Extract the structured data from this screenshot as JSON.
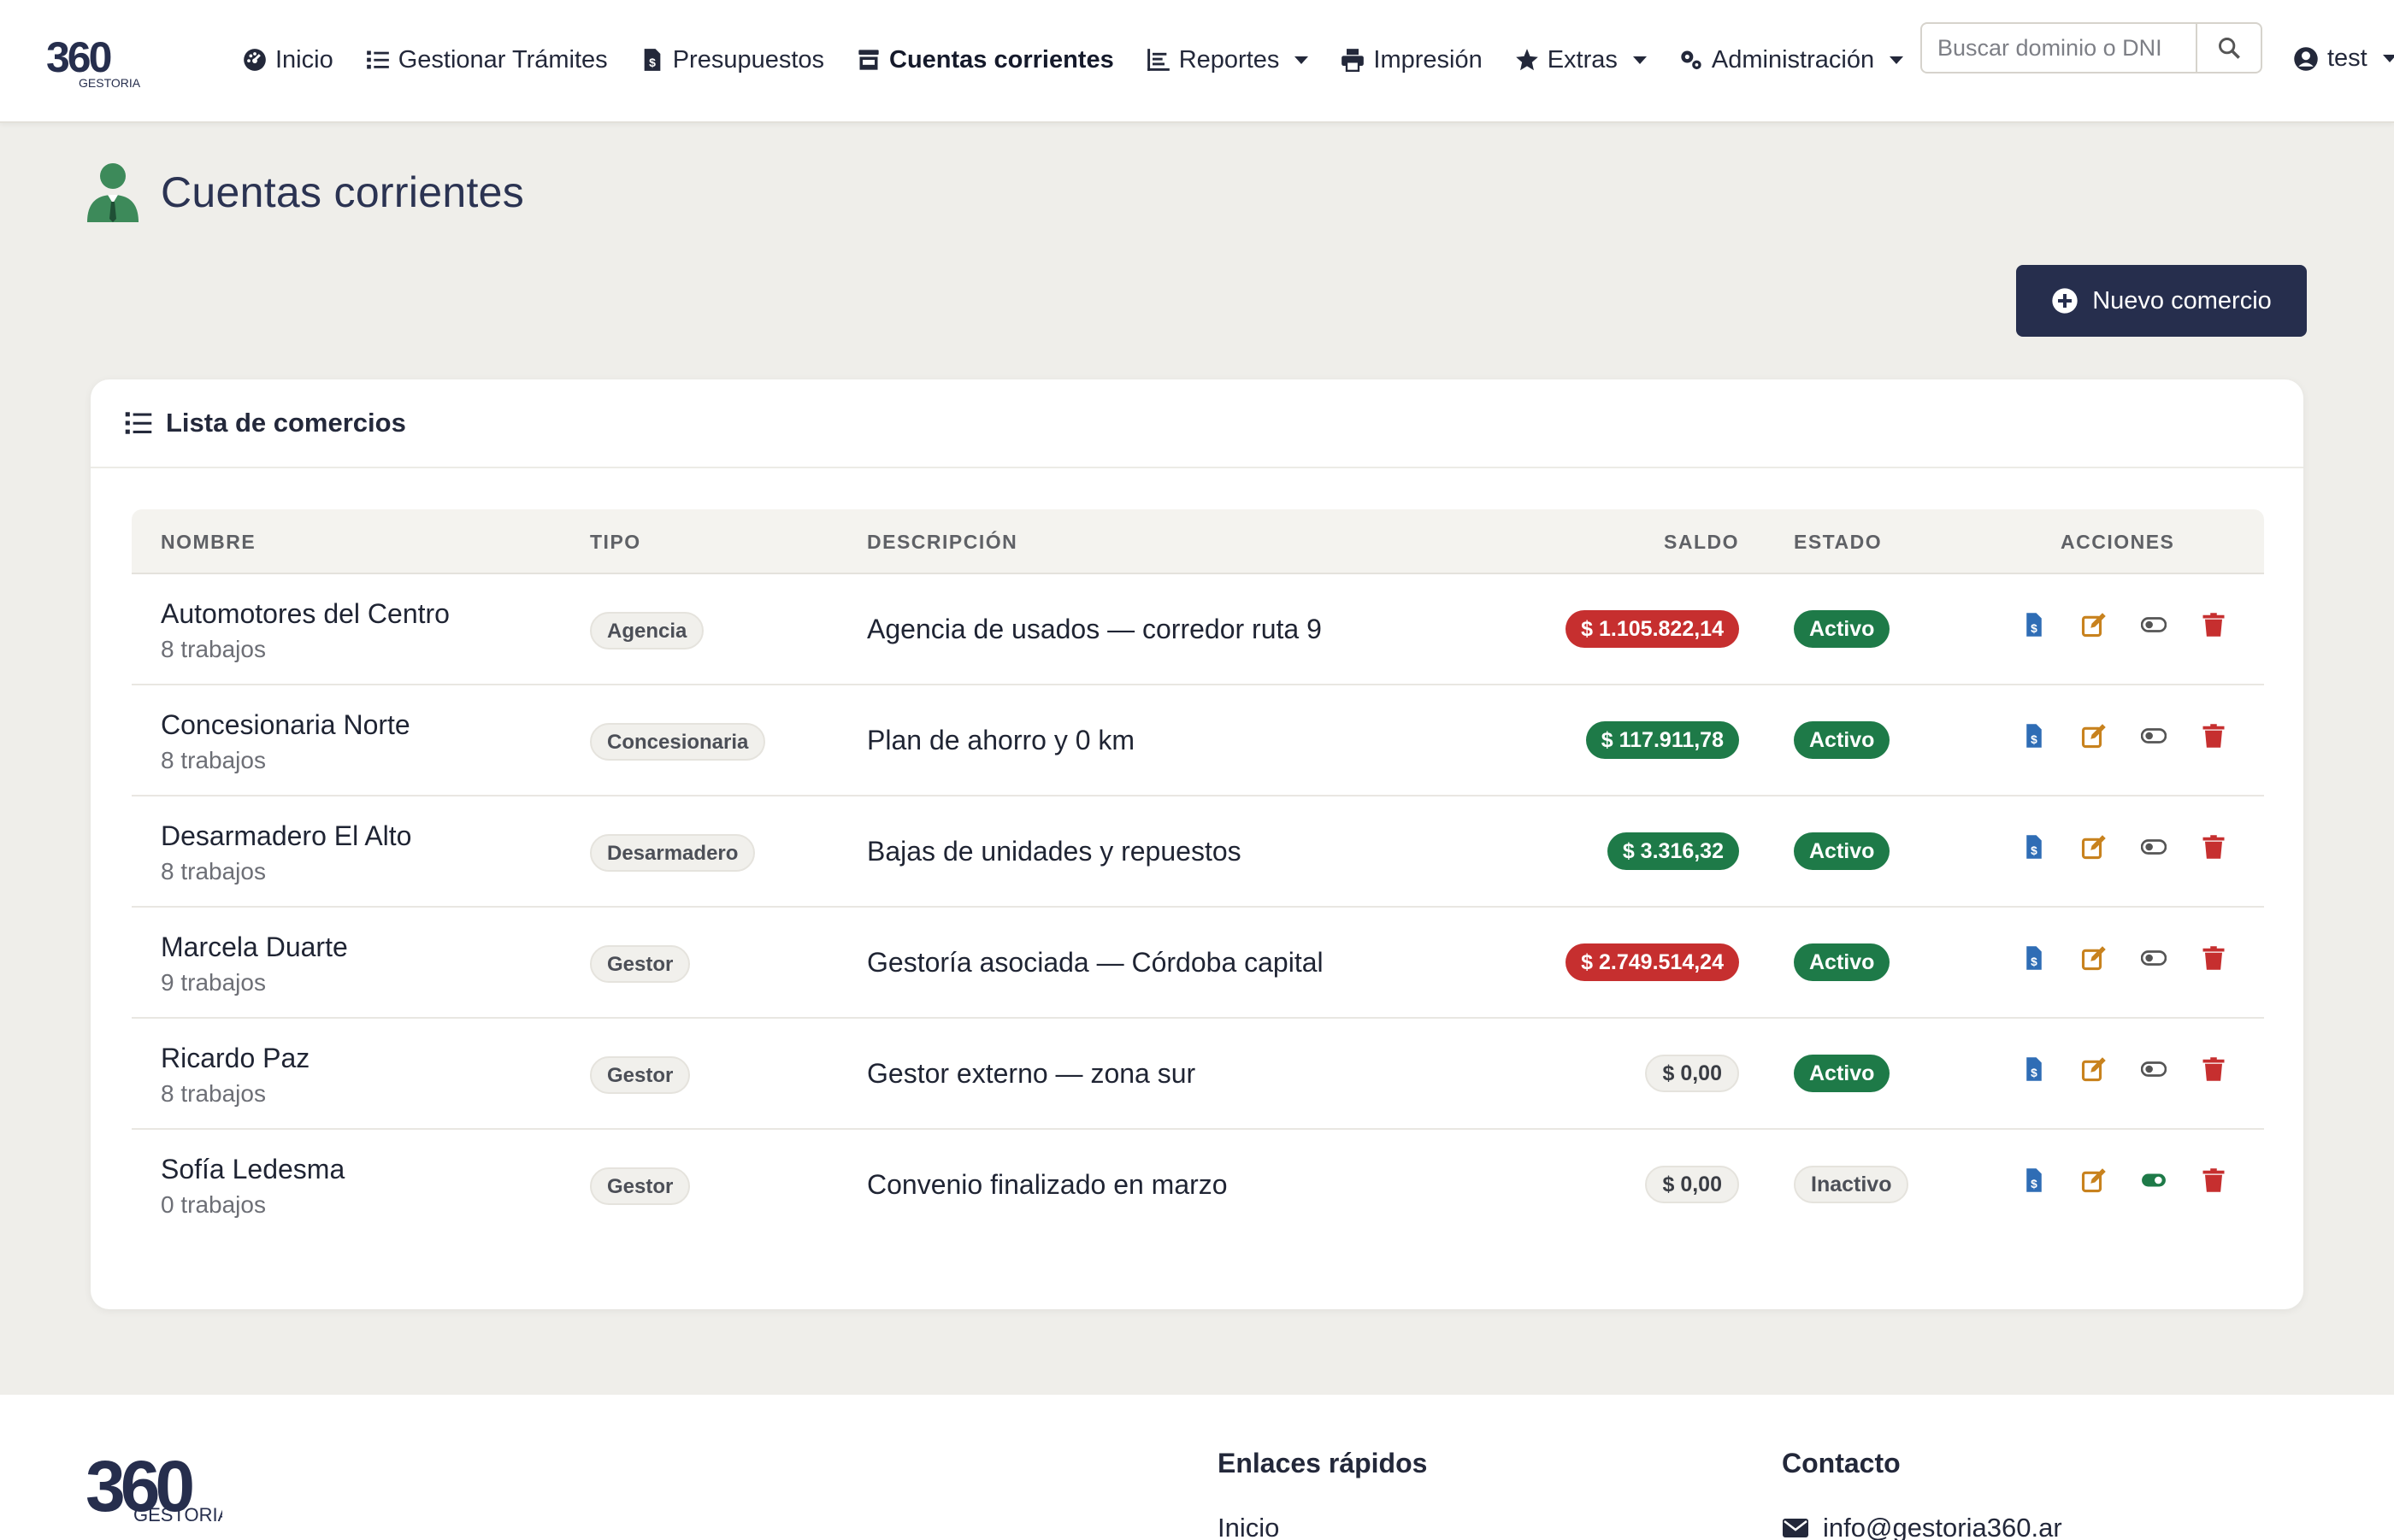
{
  "brand": {
    "number": "360",
    "name": "GESTORIA"
  },
  "nav": {
    "items": [
      {
        "label": "Inicio",
        "icon": "dashboard-icon"
      },
      {
        "label": "Gestionar Trámites",
        "icon": "list-icon"
      },
      {
        "label": "Presupuestos",
        "icon": "invoice-icon"
      },
      {
        "label": "Cuentas corrientes",
        "icon": "store-icon"
      },
      {
        "label": "Reportes",
        "icon": "chart-icon"
      },
      {
        "label": "Impresión",
        "icon": "printer-icon"
      },
      {
        "label": "Extras",
        "icon": "star-icon"
      },
      {
        "label": "Administración",
        "icon": "gears-icon"
      }
    ],
    "search_placeholder": "Buscar dominio o DNI",
    "user": "test"
  },
  "page": {
    "title": "Cuentas corrientes",
    "new_button": "Nuevo comercio"
  },
  "card": {
    "title": "Lista de comercios",
    "columns": [
      "NOMBRE",
      "TIPO",
      "DESCRIPCIÓN",
      "SALDO",
      "ESTADO",
      "ACCIONES"
    ],
    "rows": [
      {
        "nombre": "Automotores del Centro",
        "trabajos": "8 trabajos",
        "tipo": "Agencia",
        "descripcion": "Agencia de usados — corredor ruta 9",
        "saldo": "$ 1.105.822,14",
        "saldo_kind": "neg",
        "estado": "Activo",
        "estado_kind": "on"
      },
      {
        "nombre": "Concesionaria Norte",
        "trabajos": "8 trabajos",
        "tipo": "Concesionaria",
        "descripcion": "Plan de ahorro y 0 km",
        "saldo": "$ 117.911,78",
        "saldo_kind": "pos",
        "estado": "Activo",
        "estado_kind": "on"
      },
      {
        "nombre": "Desarmadero El Alto",
        "trabajos": "8 trabajos",
        "tipo": "Desarmadero",
        "descripcion": "Bajas de unidades y repuestos",
        "saldo": "$ 3.316,32",
        "saldo_kind": "pos",
        "estado": "Activo",
        "estado_kind": "on"
      },
      {
        "nombre": "Marcela Duarte",
        "trabajos": "9 trabajos",
        "tipo": "Gestor",
        "descripcion": "Gestoría asociada — Córdoba capital",
        "saldo": "$ 2.749.514,24",
        "saldo_kind": "neg",
        "estado": "Activo",
        "estado_kind": "on"
      },
      {
        "nombre": "Ricardo Paz",
        "trabajos": "8 trabajos",
        "tipo": "Gestor",
        "descripcion": "Gestor externo — zona sur",
        "saldo": "$ 0,00",
        "saldo_kind": "zero",
        "estado": "Activo",
        "estado_kind": "on"
      },
      {
        "nombre": "Sofía Ledesma",
        "trabajos": "0 trabajos",
        "tipo": "Gestor",
        "descripcion": "Convenio finalizado en marzo",
        "saldo": "$ 0,00",
        "saldo_kind": "zero",
        "estado": "Inactivo",
        "estado_kind": "off"
      }
    ]
  },
  "footer": {
    "quick_links_title": "Enlaces rápidos",
    "quick_link_1": "Inicio",
    "contact_title": "Contacto",
    "email": "info@gestoria360.ar"
  },
  "colors": {
    "navy": "#262e4d",
    "green": "#1e7a48",
    "red": "#c62f2f",
    "blue": "#2f6db5",
    "orange": "#c8821e",
    "person": "#3d8a5a"
  }
}
